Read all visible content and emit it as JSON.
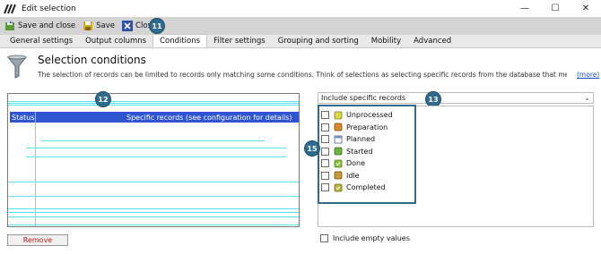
{
  "window": {
    "title": "Edit selection",
    "controls": {
      "minimize": "—",
      "maximize": "☐",
      "close": "✕"
    }
  },
  "toolbar": {
    "save_close_label": "Save and close",
    "save_label": "Save",
    "close_label": "Close"
  },
  "badges": {
    "b11": "11",
    "b12": "12",
    "b13": "13",
    "b15": "15"
  },
  "tabs": [
    {
      "label": "General settings"
    },
    {
      "label": "Output columns"
    },
    {
      "label": "Conditions"
    },
    {
      "label": "Filter settings"
    },
    {
      "label": "Grouping and sorting"
    },
    {
      "label": "Mobility"
    },
    {
      "label": "Advanced"
    }
  ],
  "header": {
    "title": "Selection conditions",
    "description": "The selection of records can be limited to records only matching some conditions. Think of selections as selecting specific records from the database that meets certain...",
    "more_link": "(more)"
  },
  "grid": {
    "col_status": "Status",
    "col_records": "Specific records (see configuration for details)"
  },
  "remove_label": "Remove",
  "dropdown": {
    "value": "Include specific records"
  },
  "statuses": [
    {
      "label": "Unprocessed",
      "icon": "unprocessed-icon",
      "color": "#d9d94a"
    },
    {
      "label": "Preparation",
      "icon": "preparation-icon",
      "color": "#d98c2a"
    },
    {
      "label": "Planned",
      "icon": "planned-icon",
      "color": "#7a8fc0"
    },
    {
      "label": "Started",
      "icon": "started-icon",
      "color": "#6cb33f"
    },
    {
      "label": "Done",
      "icon": "done-icon",
      "color": "#8fc43f"
    },
    {
      "label": "Idle",
      "icon": "idle-icon",
      "color": "#c99a3a"
    },
    {
      "label": "Completed",
      "icon": "completed-icon",
      "color": "#b8b83a"
    }
  ],
  "include_empty_label": "Include empty values",
  "colors": {
    "accent": "#2f56d0",
    "badge": "#2f6b8f",
    "toolbar_bg": "#d4d4d4",
    "remove_text": "#c02020"
  }
}
